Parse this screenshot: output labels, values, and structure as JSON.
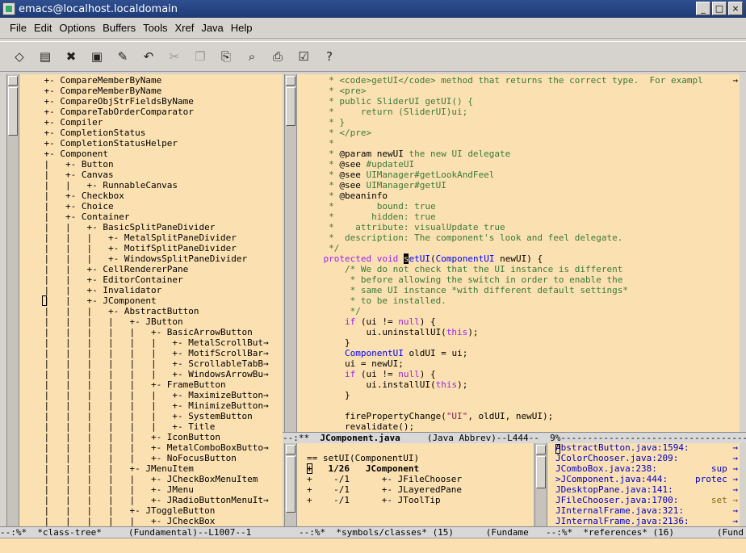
{
  "window": {
    "title": "emacs@localhost.localdomain",
    "buttons": [
      "_",
      "□",
      "×"
    ]
  },
  "menubar": [
    "File",
    "Edit",
    "Options",
    "Buffers",
    "Tools",
    "Xref",
    "Java",
    "Help"
  ],
  "toolbar": {
    "icons": [
      "new-file-icon",
      "open-folder-icon",
      "close-icon",
      "save-icon",
      "save-as-icon",
      "undo-icon",
      "cut-icon",
      "copy-icon",
      "paste-icon",
      "search-icon",
      "print-icon",
      "preferences-icon",
      "help-icon"
    ]
  },
  "class_tree": {
    "lines": [
      "    +- CompareMemberByName",
      "    +- CompareMemberByName",
      "    +- CompareObjStrFieldsByName",
      "    +- CompareTabOrderComparator",
      "    +- Compiler",
      "    +- CompletionStatus",
      "    +- CompletionStatusHelper",
      "    +- Component",
      "    |   +- Button",
      "    |   +- Canvas",
      "    |   |   +- RunnableCanvas",
      "    |   +- Checkbox",
      "    |   +- Choice",
      "    |   +- Container",
      "    |   |   +- BasicSplitPaneDivider",
      "    |   |   |   +- MetalSplitPaneDivider",
      "    |   |   |   +- MotifSplitPaneDivider",
      "    |   |   |   +- WindowsSplitPaneDivider",
      "    |   |   +- CellRendererPane",
      "    |   |   +- EditorContainer",
      "    |   |   +- Invalidator",
      "    |   |   +- JComponent",
      "    |   |   |   +- AbstractButton",
      "    |   |   |   |   +- JButton",
      "    |   |   |   |   |   +- BasicArrowButton",
      "    |   |   |   |   |   |   +- MetalScrollBut",
      "    |   |   |   |   |   |   +- MotifScrollBar",
      "    |   |   |   |   |   |   +- ScrollableTabB",
      "    |   |   |   |   |   |   +- WindowsArrowBu",
      "    |   |   |   |   |   +- FrameButton",
      "    |   |   |   |   |   |   +- MaximizeButton",
      "    |   |   |   |   |   |   +- MinimizeButton",
      "    |   |   |   |   |   |   +- SystemButton",
      "    |   |   |   |   |   |   +- Title",
      "    |   |   |   |   |   +- IconButton",
      "    |   |   |   |   |   +- MetalComboBoxButto",
      "    |   |   |   |   |   +- NoFocusButton",
      "    |   |   |   |   +- JMenuItem",
      "    |   |   |   |   |   +- JCheckBoxMenuItem",
      "    |   |   |   |   |   +- JMenu",
      "    |   |   |   |   |   +- JRadioButtonMenuIt",
      "    |   |   |   |   +- JToggleButton",
      "    |   |   |   |   |   +- JCheckBox"
    ],
    "truncated_marker": "→",
    "modeline": "--:%*  *class-tree*     (Fundamental)--L1007--1"
  },
  "source": {
    "modeline_left": "--:**  ",
    "modeline_buffer": "JComponent.java",
    "modeline_mode": "     (Java Abbrev)--L444--  9%",
    "modeline_fill": "-------------------------------------------"
  },
  "symbols": {
    "lines": [
      "",
      "== setUI(ComponentUI)",
      "+   1/26   JComponent",
      "+    -/1      +- JFileChooser",
      "+    -/1      +- JLayeredPane",
      "+    -/1      +- JToolTip"
    ],
    "modeline": "--:%*  *symbols/classes* (15)      (Fundame"
  },
  "references": {
    "lines": [
      "AbstractButton.java:1594:",
      "JColorChooser.java:209:",
      "JComboBox.java:238:",
      ">JComponent.java:444:",
      "JDesktopPane.java:141:",
      "JFileChooser.java:1700:",
      "JInternalFrame.java:321:",
      "JInternalFrame.java:2136:"
    ],
    "tails": [
      "",
      "",
      "sup",
      "protec",
      "",
      "set",
      "",
      ""
    ],
    "modeline": "--:%*  *references* (16)        (Fund"
  }
}
